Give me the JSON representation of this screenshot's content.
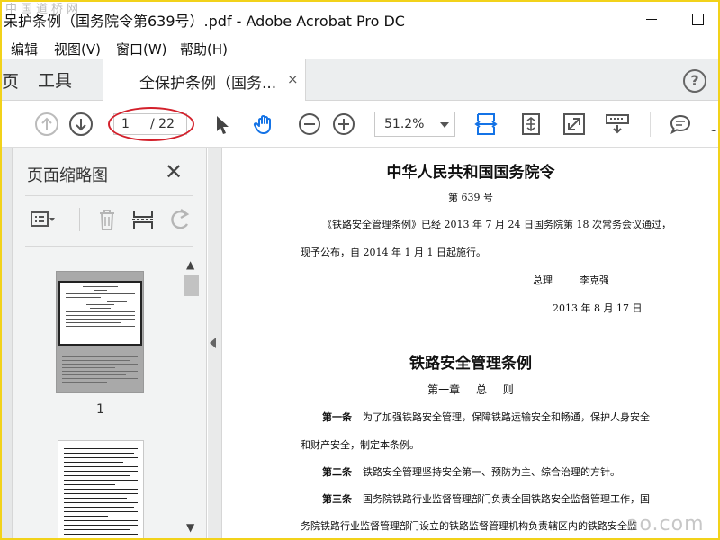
{
  "watermark_top": "中国道桥网",
  "watermark_bottom": "ao.com",
  "window": {
    "title": "呆护条例（国务院令第639号）.pdf - Adobe Acrobat Pro DC"
  },
  "menu": [
    "编辑",
    "视图(V)",
    "窗口(W)",
    "帮助(H)"
  ],
  "tabs": {
    "home_fragment": "页",
    "tools": "工具",
    "active_doc": "全保护条例（国务...",
    "close_glyph": "×",
    "help_glyph": "?"
  },
  "toolbar": {
    "page_current": "1",
    "page_total": "/ 22",
    "zoom": "51.2%",
    "accent_color": "#1473e6",
    "highlight_color": "#d3202b"
  },
  "left_panel": {
    "title": "页面缩略图",
    "close_glyph": "✕",
    "thumbnails": [
      {
        "label": "1"
      }
    ],
    "scroll_up": "▲",
    "scroll_down": "▼"
  },
  "document": {
    "heading": "中华人民共和国国务院令",
    "order_no": "第 639 号",
    "para1_line1": "《铁路安全管理条例》已经 2013 年 7 月 24 日国务院第 18 次常务会议通过，",
    "para1_line2": "现予公布，自 2014 年 1 月 1 日起施行。",
    "signer_title": "总理",
    "signer_name": "李克强",
    "date": "2013 年 8 月 17 日",
    "title": "铁路安全管理条例",
    "chapter": "第一章 总 则",
    "articles": [
      {
        "label": "第一条",
        "line1": "为了加强铁路安全管理，保障铁路运输安全和畅通，保护人身安全",
        "line2": "和财产安全，制定本条例。"
      },
      {
        "label": "第二条",
        "line1": "铁路安全管理坚持安全第一、预防为主、综合治理的方针。"
      },
      {
        "label": "第三条",
        "line1": "国务院铁路行业监督管理部门负责全国铁路安全监督管理工作，国",
        "line2": "务院铁路行业监督管理部门设立的铁路监督管理机构负责辖区内的铁路安全监"
      }
    ]
  }
}
